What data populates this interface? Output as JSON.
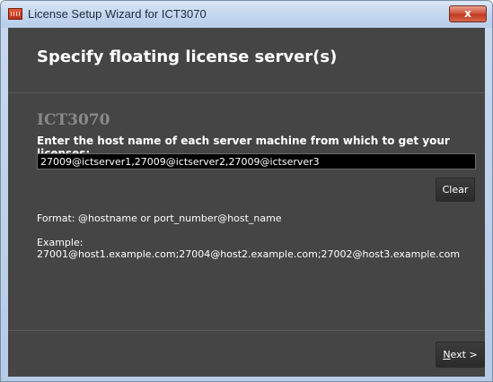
{
  "window": {
    "title": "License Setup Wizard for ICT3070",
    "close_glyph": "x"
  },
  "header": {
    "title": "Specify floating license server(s)"
  },
  "form": {
    "section_title": "ICT3070",
    "instruction": "Enter the host name of each server machine from which to get your licenses:",
    "server_value": "27009@ictserver1,27009@ictserver2,27009@ictserver3",
    "clear_label": "Clear",
    "format_text": "Format: @hostname or port_number@host_name",
    "example_label": "Example:",
    "example_value": "27001@host1.example.com;27004@host2.example.com;27002@host3.example.com"
  },
  "footer": {
    "next_mnemonic": "N",
    "next_rest": "ext >"
  },
  "icons": {
    "app": "app-icon",
    "close": "close-icon"
  },
  "colors": {
    "panel_bg": "#454545",
    "input_bg": "#000000",
    "section_title": "#8a8a8a",
    "close_red": "#c23a22"
  }
}
